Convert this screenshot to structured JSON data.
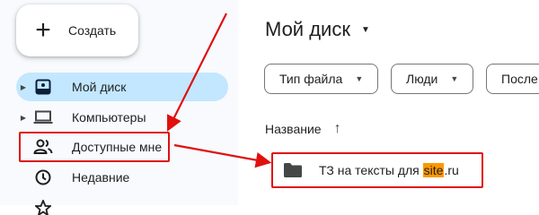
{
  "sidebar": {
    "create_button": {
      "label": "Создать",
      "icon": "plus-icon"
    },
    "items": [
      {
        "label": "Мой диск",
        "icon": "drive-icon",
        "active": true,
        "expandable": true
      },
      {
        "label": "Компьютеры",
        "icon": "computer-icon",
        "active": false,
        "expandable": true
      },
      {
        "label": "Доступные мне",
        "icon": "shared-people-icon",
        "active": false,
        "expandable": false
      },
      {
        "label": "Недавние",
        "icon": "clock-icon",
        "active": false,
        "expandable": false
      }
    ]
  },
  "main": {
    "title": "Мой диск",
    "filters": [
      {
        "label": "Тип файла"
      },
      {
        "label": "Люди"
      },
      {
        "label": "После"
      }
    ],
    "column_header": "Название",
    "file": {
      "name_prefix": "ТЗ на тексты для ",
      "name_highlight": "site",
      "name_suffix": ".ru",
      "icon": "folder-icon"
    }
  },
  "colors": {
    "active_bg": "#c2e7ff",
    "annotation_red": "#e0100f",
    "highlight_orange": "#ff9800",
    "sidebar_bg": "#f8fafd"
  }
}
